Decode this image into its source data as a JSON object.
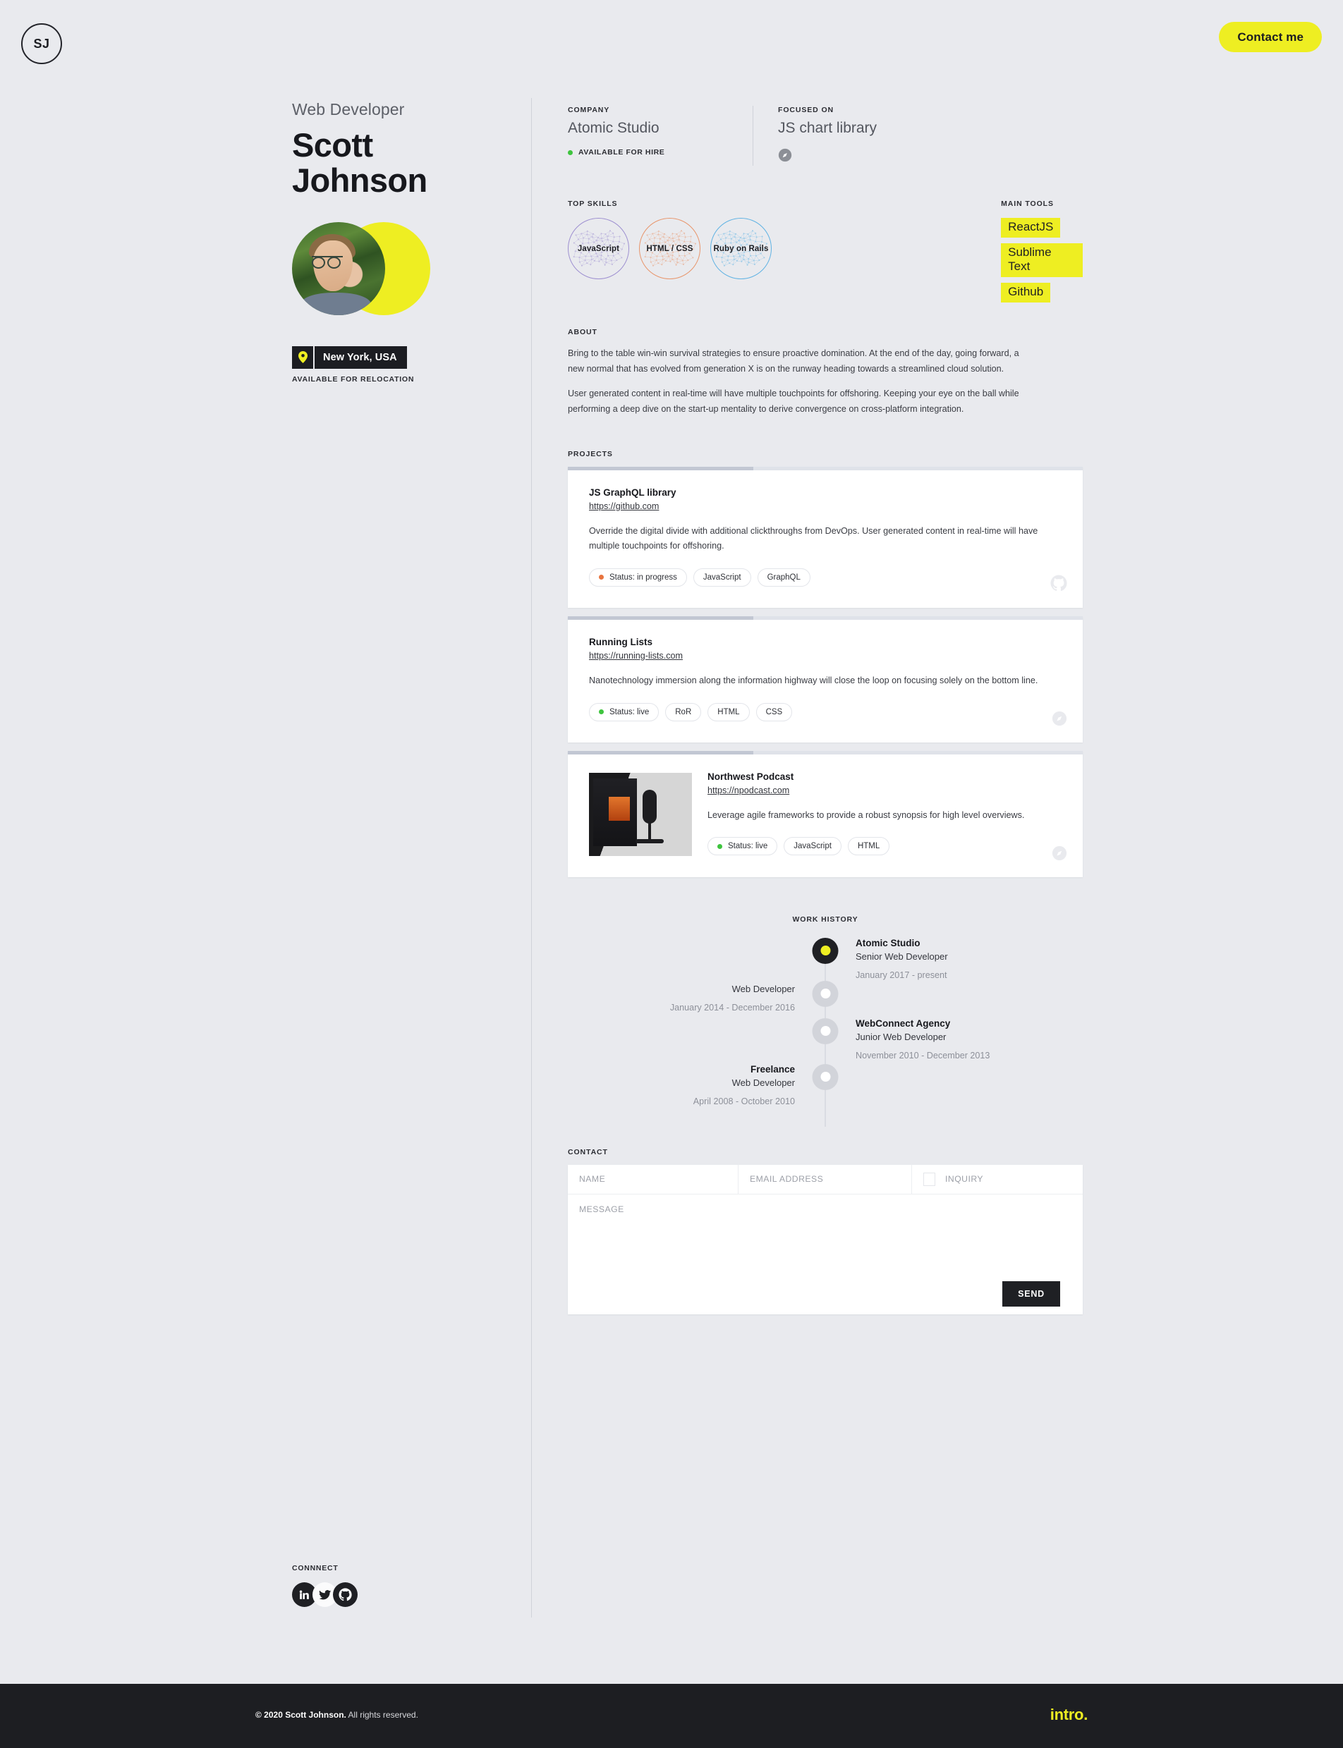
{
  "topbar": {
    "logo_initials": "SJ",
    "contact_button": "Contact me"
  },
  "profile": {
    "role": "Web Developer",
    "first_name": "Scott",
    "last_name": "Johnson",
    "location": "New York, USA",
    "relocation_note": "AVAILABLE FOR RELOCATION",
    "location_pin_icon": "map-pin-icon",
    "avatar_icon": "avatar-photo"
  },
  "header": {
    "company_kicker": "COMPANY",
    "company_name": "Atomic Studio",
    "availability": "AVAILABLE FOR HIRE",
    "availability_color": "#3ec43e",
    "focus_kicker": "FOCUSED ON",
    "focus_value": "JS chart library",
    "focus_icon": "compass-icon"
  },
  "skills": {
    "kicker": "TOP SKILLS",
    "items": [
      {
        "label": "JavaScript",
        "color": "#9d8fd0"
      },
      {
        "label": "HTML / CSS",
        "color": "#e8956b"
      },
      {
        "label": "Ruby on Rails",
        "color": "#5fb2e3"
      }
    ]
  },
  "tools": {
    "kicker": "MAIN TOOLS",
    "highlight_color": "#eeee22",
    "items": [
      "ReactJS",
      "Sublime Text",
      "Github"
    ]
  },
  "about": {
    "kicker": "ABOUT",
    "paragraphs": [
      "Bring to the table win-win survival strategies to ensure proactive domination. At the end of the day, going forward, a new normal that has evolved from generation X is on the runway heading towards a streamlined cloud solution.",
      "User generated content in real-time will have multiple touchpoints for offshoring. Keeping your eye on the ball while performing a deep dive on the start-up mentality to derive convergence on cross-platform integration."
    ]
  },
  "projects": {
    "kicker": "PROJECTS",
    "items": [
      {
        "title": "JS GraphQL library",
        "url": "https://github.com",
        "description": "Override the digital divide with additional clickthroughs from DevOps. User generated content in real-time will have multiple touchpoints for offshoring.",
        "status": "Status: in progress",
        "status_color": "#e8743f",
        "tags": [
          "JavaScript",
          "GraphQL"
        ],
        "corner_icon": "github-icon",
        "progress_percent": 36,
        "has_thumbnail": false
      },
      {
        "title": "Running Lists",
        "url": "https://running-lists.com",
        "description": "Nanotechnology immersion along the information highway will close the loop on focusing solely on the bottom line.",
        "status": "Status: live",
        "status_color": "#3ec43e",
        "tags": [
          "RoR",
          "HTML",
          "CSS"
        ],
        "corner_icon": "compass-icon",
        "progress_percent": 36,
        "has_thumbnail": false
      },
      {
        "title": "Northwest Podcast",
        "url": "https://npodcast.com",
        "description": "Leverage agile frameworks to provide a robust synopsis for high level overviews.",
        "status": "Status: live",
        "status_color": "#3ec43e",
        "tags": [
          "JavaScript",
          "HTML"
        ],
        "corner_icon": "compass-icon",
        "progress_percent": 36,
        "has_thumbnail": true,
        "thumbnail_icon": "podcast-desk-photo"
      }
    ]
  },
  "work_history": {
    "kicker": "WORK HISTORY",
    "items": [
      {
        "company": "Atomic Studio",
        "role": "Senior Web Developer",
        "dates": "January 2017 - present",
        "side": "right",
        "active": true
      },
      {
        "company": "",
        "role": "Web Developer",
        "dates": "January 2014 - December 2016",
        "side": "left",
        "active": false
      },
      {
        "company": "WebConnect Agency",
        "role": "Junior Web Developer",
        "dates": "November 2010 - December 2013",
        "side": "right",
        "active": false
      },
      {
        "company": "Freelance",
        "role": "Web Developer",
        "dates": "April 2008 - October 2010",
        "side": "left",
        "active": false
      }
    ]
  },
  "contact": {
    "kicker": "CONTACT",
    "name_placeholder": "NAME",
    "name_value": "",
    "email_placeholder": "EMAIL ADDRESS",
    "email_value": "",
    "inquiry_label": "INQUIRY",
    "inquiry_checked": false,
    "message_placeholder": "MESSAGE",
    "message_value": "",
    "send_label": "SEND"
  },
  "connect": {
    "kicker": "CONNNECT",
    "items": [
      {
        "icon": "linkedin-icon",
        "style": "dark"
      },
      {
        "icon": "twitter-icon",
        "style": "light"
      },
      {
        "icon": "github-icon",
        "style": "dark"
      }
    ]
  },
  "footer": {
    "copyright_bold": "© 2020 Scott Johnson.",
    "copyright_rest": " All rights reserved.",
    "logo": "intro",
    "logo_dot": ".",
    "logo_dot_color": "#eeee22"
  }
}
